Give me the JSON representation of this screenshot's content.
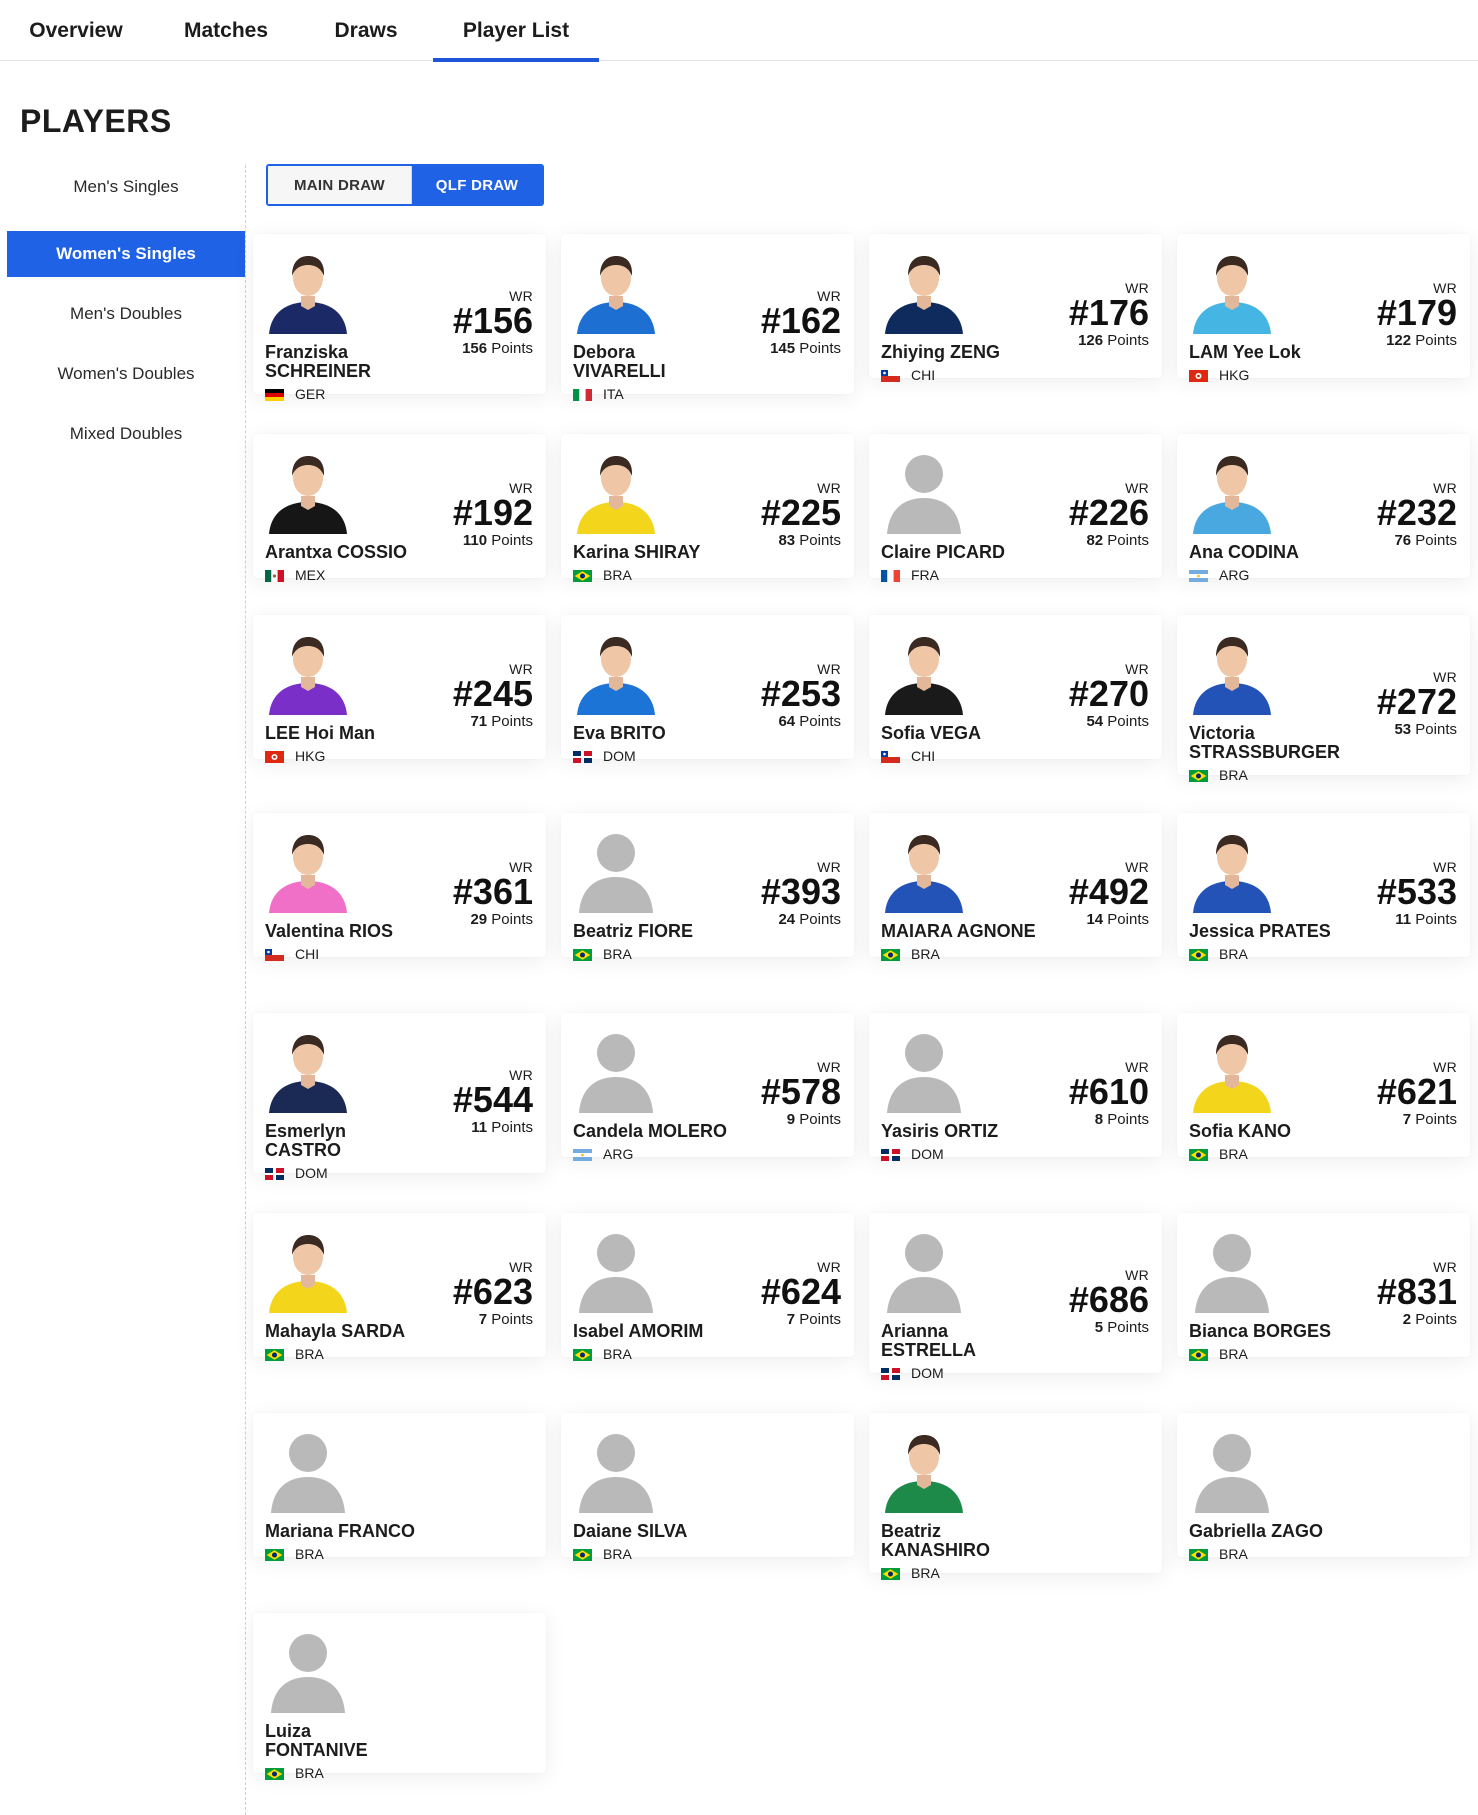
{
  "tabs": [
    "Overview",
    "Matches",
    "Draws",
    "Player List"
  ],
  "active_tab": "Player List",
  "page_title": "PLAYERS",
  "sidebar": {
    "items": [
      "Men's Singles",
      "Women's Singles",
      "Men's Doubles",
      "Women's Doubles",
      "Mixed Doubles"
    ],
    "active": "Women's Singles"
  },
  "draw_toggle": {
    "main": "MAIN DRAW",
    "qlf": "QLF DRAW",
    "active": "QLF DRAW"
  },
  "labels": {
    "wr": "WR",
    "points": "Points"
  },
  "colors": {
    "accent": "#1f62e6",
    "tab_underline": "#1f55d8",
    "silhouette": "#b7b7b7"
  },
  "players": [
    {
      "first": "Franziska",
      "last": "SCHREINER",
      "country": "GER",
      "rank": "#156",
      "points": "156",
      "photo": true,
      "shirt": "#1b2a66"
    },
    {
      "first": "Debora",
      "last": "VIVARELLI",
      "country": "ITA",
      "rank": "#162",
      "points": "145",
      "photo": true,
      "shirt": "#1e6fd2"
    },
    {
      "first": "Zhiying",
      "last": "ZENG",
      "country": "CHI",
      "rank": "#176",
      "points": "126",
      "photo": true,
      "shirt": "#0f2a5c"
    },
    {
      "first": "LAM",
      "last": "Yee Lok",
      "country": "HKG",
      "rank": "#179",
      "points": "122",
      "photo": true,
      "shirt": "#45b6e4"
    },
    {
      "first": "Arantxa",
      "last": "COSSIO",
      "country": "MEX",
      "rank": "#192",
      "points": "110",
      "photo": true,
      "shirt": "#161616"
    },
    {
      "first": "Karina",
      "last": "SHIRAY",
      "country": "BRA",
      "rank": "#225",
      "points": "83",
      "photo": true,
      "shirt": "#f3d61b"
    },
    {
      "first": "Claire",
      "last": "PICARD",
      "country": "FRA",
      "rank": "#226",
      "points": "82",
      "photo": false
    },
    {
      "first": "Ana",
      "last": "CODINA",
      "country": "ARG",
      "rank": "#232",
      "points": "76",
      "photo": true,
      "shirt": "#4aa8e0"
    },
    {
      "first": "LEE",
      "last": "Hoi Man",
      "country": "HKG",
      "rank": "#245",
      "points": "71",
      "photo": true,
      "shirt": "#7a2fc8"
    },
    {
      "first": "Eva",
      "last": "BRITO",
      "country": "DOM",
      "rank": "#253",
      "points": "64",
      "photo": true,
      "shirt": "#1c74d6"
    },
    {
      "first": "Sofia",
      "last": "VEGA",
      "country": "CHI",
      "rank": "#270",
      "points": "54",
      "photo": true,
      "shirt": "#1a1a1a"
    },
    {
      "first": "Victoria",
      "last": "STRASSBURGER",
      "country": "BRA",
      "rank": "#272",
      "points": "53",
      "photo": true,
      "shirt": "#2453b8"
    },
    {
      "first": "Valentina",
      "last": "RIOS",
      "country": "CHI",
      "rank": "#361",
      "points": "29",
      "photo": true,
      "shirt": "#f070c8"
    },
    {
      "first": "Beatriz",
      "last": "FIORE",
      "country": "BRA",
      "rank": "#393",
      "points": "24",
      "photo": false
    },
    {
      "first": "MAIARA",
      "last": "AGNONE",
      "country": "BRA",
      "rank": "#492",
      "points": "14",
      "photo": true,
      "shirt": "#2453b8"
    },
    {
      "first": "Jessica",
      "last": "PRATES",
      "country": "BRA",
      "rank": "#533",
      "points": "11",
      "photo": true,
      "shirt": "#2453b8"
    },
    {
      "first": "Esmerlyn",
      "last": "CASTRO",
      "country": "DOM",
      "rank": "#544",
      "points": "11",
      "photo": true,
      "shirt": "#1a2a55"
    },
    {
      "first": "Candela",
      "last": "MOLERO",
      "country": "ARG",
      "rank": "#578",
      "points": "9",
      "photo": false
    },
    {
      "first": "Yasiris",
      "last": "ORTIZ",
      "country": "DOM",
      "rank": "#610",
      "points": "8",
      "photo": false
    },
    {
      "first": "Sofia",
      "last": "KANO",
      "country": "BRA",
      "rank": "#621",
      "points": "7",
      "photo": true,
      "shirt": "#f3d61b"
    },
    {
      "first": "Mahayla",
      "last": "SARDA",
      "country": "BRA",
      "rank": "#623",
      "points": "7",
      "photo": true,
      "shirt": "#f3d61b"
    },
    {
      "first": "Isabel",
      "last": "AMORIM",
      "country": "BRA",
      "rank": "#624",
      "points": "7",
      "photo": false
    },
    {
      "first": "Arianna",
      "last": "ESTRELLA",
      "country": "DOM",
      "rank": "#686",
      "points": "5",
      "photo": false
    },
    {
      "first": "Bianca",
      "last": "BORGES",
      "country": "BRA",
      "rank": "#831",
      "points": "2",
      "photo": false
    },
    {
      "first": "Mariana",
      "last": "FRANCO",
      "country": "BRA",
      "rank": "",
      "points": "",
      "photo": false
    },
    {
      "first": "Daiane",
      "last": "SILVA",
      "country": "BRA",
      "rank": "",
      "points": "",
      "photo": false
    },
    {
      "first": "Beatriz",
      "last": "KANASHIRO",
      "country": "BRA",
      "rank": "",
      "points": "",
      "photo": true,
      "shirt": "#1d8a4a"
    },
    {
      "first": "Gabriella",
      "last": "ZAGO",
      "country": "BRA",
      "rank": "",
      "points": "",
      "photo": false
    },
    {
      "first": "Luiza",
      "last": "FONTANIVE",
      "country": "BRA",
      "rank": "",
      "points": "",
      "photo": false
    }
  ]
}
